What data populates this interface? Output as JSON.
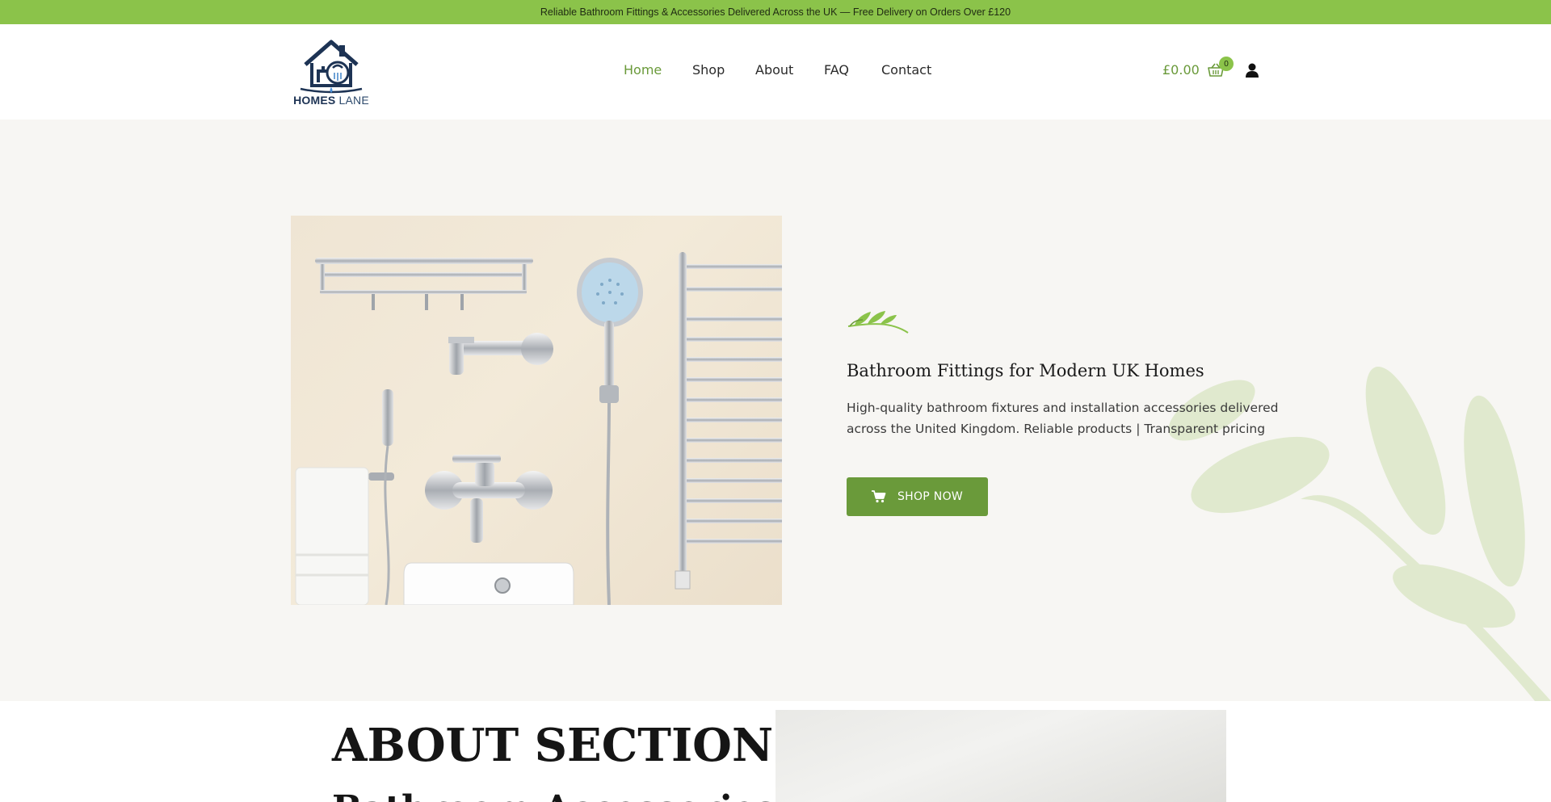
{
  "announcement": "Reliable Bathroom Fittings & Accessories Delivered Across the UK — Free Delivery on Orders Over £120",
  "brand": {
    "name_primary": "HOMES",
    "name_secondary": "LANE",
    "color_primary": "#1d3354"
  },
  "nav": {
    "items": [
      {
        "label": "Home",
        "active": true
      },
      {
        "label": "Shop",
        "active": false
      },
      {
        "label": "About",
        "active": false
      },
      {
        "label": "FAQ",
        "active": false
      },
      {
        "label": "Contact",
        "active": false
      }
    ]
  },
  "cart": {
    "total": "£0.00",
    "count": "0",
    "icon": "basket-icon"
  },
  "account": {
    "icon": "user-icon"
  },
  "hero": {
    "title": "Bathroom Fittings for Modern UK Homes",
    "description": "High-quality bathroom fixtures and installation accessories delivered across the United Kingdom. Reliable products | Transparent pricing",
    "cta_label": "SHOP NOW",
    "cta_icon": "cart-icon"
  },
  "about": {
    "title": "ABOUT SECTION",
    "subtitle": "Bathroom Accessories"
  },
  "colors": {
    "accent": "#8bc34a",
    "accent_dark": "#6a9a3a",
    "hero_bg": "#f7f6f3"
  }
}
